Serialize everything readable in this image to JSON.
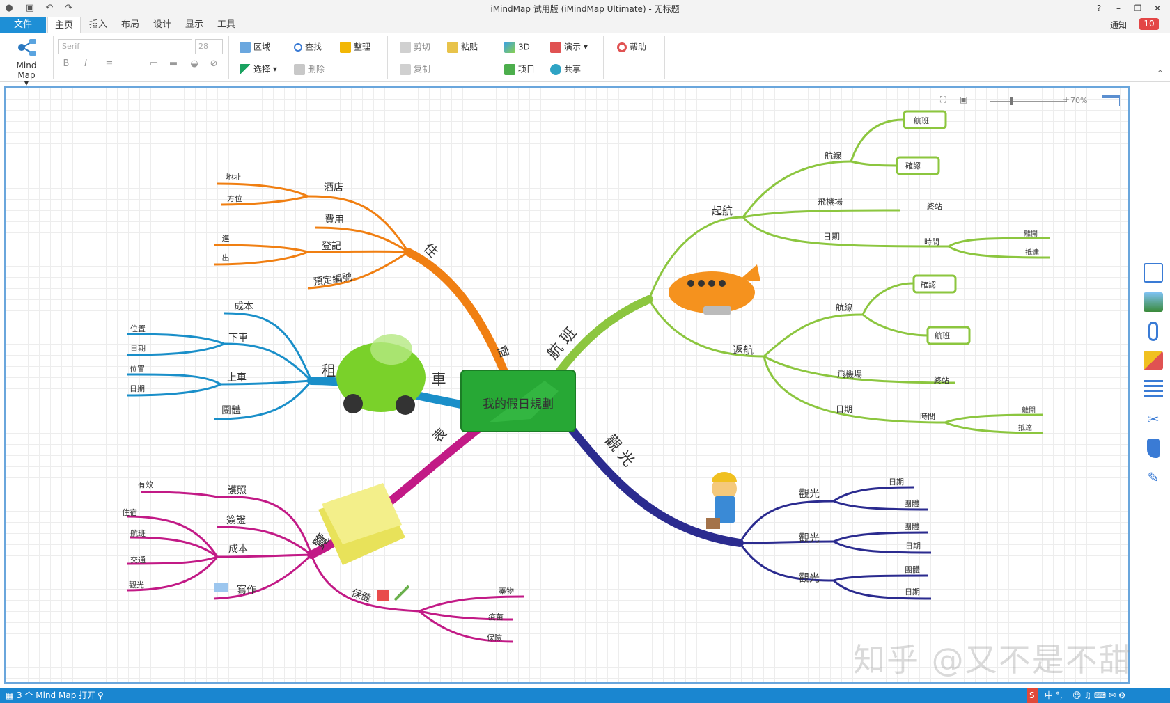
{
  "window": {
    "title": "iMindMap 试用版 (iMindMap Ultimate) - 无标题",
    "help_label": "?",
    "minimize_label": "–",
    "restore_label": "❐",
    "close_label": "✕"
  },
  "menu": {
    "tabs": [
      "文件",
      "主页",
      "插入",
      "布局",
      "设计",
      "显示",
      "工具"
    ],
    "active": "主页",
    "notify_label": "通知",
    "notify_count": "10"
  },
  "ribbon": {
    "mindmap_label": "Mind Map",
    "font_name": "Serif",
    "font_size": "28",
    "region": "区域",
    "find": "查找",
    "arrange": "整理",
    "select": "选择",
    "delete": "删除",
    "cut": "剪切",
    "paste": "粘贴",
    "copy": "复制",
    "threed": "3D",
    "present": "演示",
    "project": "项目",
    "share": "共享",
    "help": "帮助"
  },
  "zoom": {
    "level": "70%"
  },
  "mindmap": {
    "center": "我的假日規劃",
    "branches": {
      "flight": {
        "label": "航 班",
        "color": "#8cc63f",
        "outbound": "起航",
        "return": "返航",
        "route": "航線",
        "airport": "飛機場",
        "date": "日期",
        "terminal": "終站",
        "time": "時間",
        "depart": "離開",
        "arrive": "抵達",
        "flight_box": "航班",
        "confirm_box": "確認"
      },
      "sightseeing": {
        "label": "觀 光",
        "color": "#2b2b8f",
        "items": [
          "觀光",
          "觀光",
          "觀光"
        ],
        "subitems": [
          [
            "日期",
            "團體"
          ],
          [
            "團體",
            "日期"
          ],
          [
            "團體",
            "日期"
          ]
        ]
      },
      "tour": {
        "label": "覽 表",
        "color": "#c21a86",
        "passport": "護照",
        "valid": "有效",
        "visa": "簽證",
        "cost": "成本",
        "cost_items": [
          "住宿",
          "航班",
          "交通",
          "觀光"
        ],
        "writing": "寫作",
        "health": "保健",
        "health_items": [
          "藥物",
          "疫苗",
          "保險"
        ]
      },
      "car": {
        "label": "租 車",
        "color": "#1a8fc9",
        "cost": "成本",
        "dropoff": "下車",
        "pickup": "上車",
        "group": "團體",
        "location": "位置",
        "date": "日期"
      },
      "lodging": {
        "label": "住 宿",
        "color": "#f07f12",
        "hotel": "酒店",
        "address": "地址",
        "direction": "方位",
        "fee": "費用",
        "checkin": "登記",
        "in": "進",
        "out": "出",
        "booking": "預定編號"
      }
    }
  },
  "watermark": "知乎 @又不是不甜",
  "status": {
    "open_maps": "3 个 Mind Map 打开"
  }
}
